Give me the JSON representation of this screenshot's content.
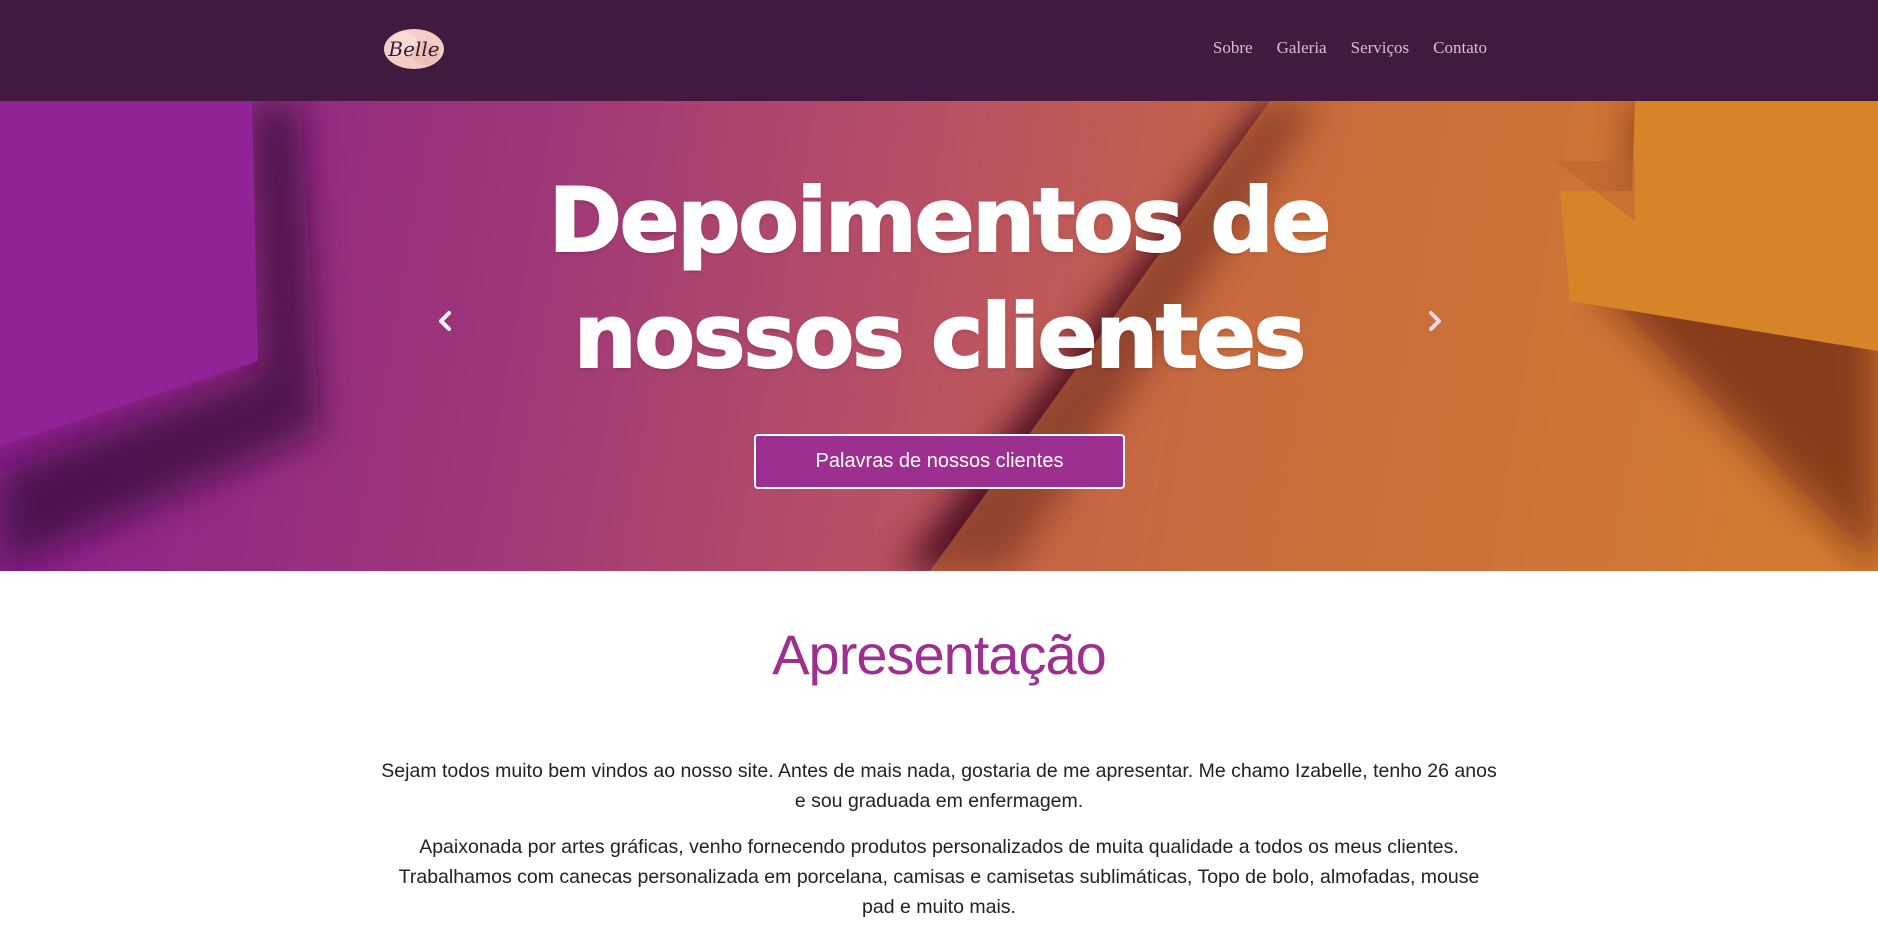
{
  "navbar": {
    "logo_text": "Belle",
    "links": [
      "Sobre",
      "Galeria",
      "Serviços",
      "Contato"
    ]
  },
  "hero": {
    "title_line1": "Depoimentos de",
    "title_line2": "nossos clientes",
    "button_label": "Palavras de nossos clientes",
    "prev_icon": "chevron-left-icon",
    "next_icon": "chevron-right-icon"
  },
  "content": {
    "section_title": "Apresentação",
    "paragraphs": [
      "Sejam todos muito bem vindos ao nosso site. Antes de mais nada, gostaria de me apresentar. Me chamo Izabelle, tenho 26 anos e sou graduada em enfermagem.",
      "Apaixonada por artes gráficas, venho fornecendo produtos personalizados de muita qualidade a todos os meus clientes. Trabalhamos com canecas personalizada em porcelana, camisas e camisetas sublimáticas, Topo de bolo, almofadas, mouse pad e muito mais."
    ]
  },
  "colors": {
    "navbar_bg": "#431a3f",
    "accent": "#9c2f8f",
    "hero_start": "#8e1f95",
    "hero_end": "#e4922a"
  }
}
